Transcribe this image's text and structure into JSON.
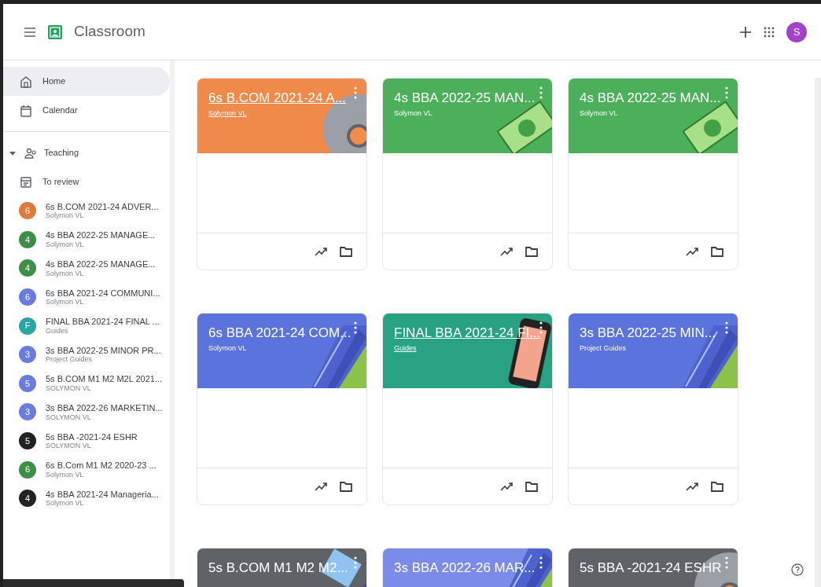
{
  "header": {
    "app_name": "Classroom",
    "avatar_letter": "S"
  },
  "sidebar": {
    "items": [
      {
        "kind": "home",
        "label": "Home",
        "selected": true
      },
      {
        "kind": "calendar",
        "label": "Calendar",
        "selected": false
      },
      {
        "kind": "section",
        "label": "Teaching",
        "expanded": true,
        "selected": false
      },
      {
        "kind": "review",
        "label": "To review",
        "selected": false
      },
      {
        "kind": "class",
        "letter": "6",
        "color": "#e07a3c",
        "label": "6s B.COM 2021-24 ADVER...",
        "subtitle": "Solymon VL",
        "selected": false
      },
      {
        "kind": "class",
        "letter": "4",
        "color": "#3d8f45",
        "label": "4s BBA 2022-25 MANAGE...",
        "subtitle": "Solymon VL",
        "selected": false
      },
      {
        "kind": "class",
        "letter": "4",
        "color": "#3d8f45",
        "label": "4s BBA 2022-25 MANAGE...",
        "subtitle": "Solymon VL",
        "selected": false
      },
      {
        "kind": "class",
        "letter": "6",
        "color": "#6a7ce0",
        "label": "6s BBA 2021-24 COMMUNI...",
        "subtitle": "Solymon VL",
        "selected": false
      },
      {
        "kind": "class",
        "letter": "F",
        "color": "#2aa7a0",
        "label": "FINAL BBA 2021-24 FINAL ...",
        "subtitle": "Guides",
        "selected": false
      },
      {
        "kind": "class",
        "letter": "3",
        "color": "#6a7ce0",
        "label": "3s BBA 2022-25 MINOR PR...",
        "subtitle": "Project Guides",
        "selected": false
      },
      {
        "kind": "class",
        "letter": "5",
        "color": "#6a7ce0",
        "label": "5s B.COM M1 M2 M2L 2021...",
        "subtitle": "SOLYMON VL",
        "selected": false
      },
      {
        "kind": "class",
        "letter": "3",
        "color": "#6a7ce0",
        "label": "3s BBA 2022-26 MARKETIN...",
        "subtitle": "SOLYMON VL",
        "selected": false
      },
      {
        "kind": "class",
        "letter": "5",
        "color": "#222222",
        "label": "5s BBA -2021-24 ESHR",
        "subtitle": "SOLYMON VL",
        "selected": false
      },
      {
        "kind": "class",
        "letter": "6",
        "color": "#3d8f45",
        "label": "6s B.Com M1 M2 2020-23 ...",
        "subtitle": "Solymon VL",
        "selected": false
      },
      {
        "kind": "class",
        "letter": "4",
        "color": "#222222",
        "label": "4s BBA 2021-24 Manageria...",
        "subtitle": "Solymon VL",
        "selected": false
      }
    ]
  },
  "cards": [
    {
      "title": "6s B.COM 2021-24 A...",
      "subtitle": "Solymon VL",
      "color": "#f08a4b",
      "underlined": true
    },
    {
      "title": "4s BBA 2022-25 MAN...",
      "subtitle": "Solymon VL",
      "color": "#4caf5a",
      "underlined": false
    },
    {
      "title": "4s BBA 2022-25 MAN...",
      "subtitle": "Solymon VL",
      "color": "#4caf5a",
      "underlined": false
    },
    {
      "title": "6s BBA 2021-24 COM...",
      "subtitle": "Solymon VL",
      "color": "#5b73dc",
      "underlined": false
    },
    {
      "title": "FINAL BBA 2021-24 FI...",
      "subtitle": "Guides",
      "color": "#27a383",
      "underlined": true
    },
    {
      "title": "3s BBA 2022-25 MIN...",
      "subtitle": "Project Guides",
      "color": "#5b73dc",
      "underlined": false
    },
    {
      "title": "5s B.COM M1 M2 M2...",
      "color": "#5f6368",
      "underlined": false
    },
    {
      "title": "3s BBA 2022-26 MAR...",
      "color": "#7b8ce8",
      "underlined": false
    },
    {
      "title": "5s BBA -2021-24 ESHR",
      "color": "#5f6368",
      "underlined": false
    }
  ]
}
